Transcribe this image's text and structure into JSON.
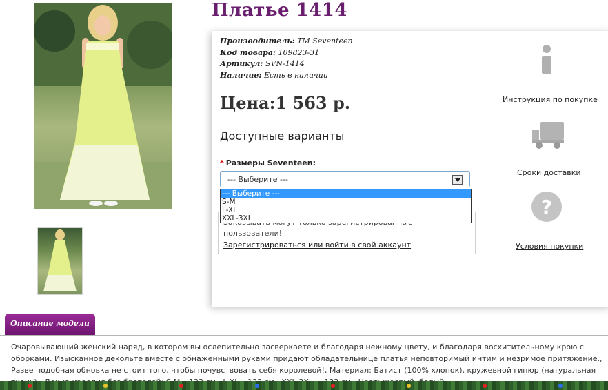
{
  "product": {
    "title": "Платье 1414",
    "meta": [
      {
        "label": "Производитель:",
        "value": "TM Seventeen"
      },
      {
        "label": "Код товара:",
        "value": "109823-31"
      },
      {
        "label": "Артикул:",
        "value": "SVN-1414"
      },
      {
        "label": "Наличие:",
        "value": "Есть в наличии"
      }
    ],
    "price": "Цена:1 563 р."
  },
  "options": {
    "heading": "Доступные варианты",
    "size_label": "Размеры Seventeen:",
    "required_mark": "*",
    "selected": "--- Выберите ---",
    "list": [
      "--- Выберите ---",
      "S-M",
      "L-XL",
      "XXL-3XL"
    ]
  },
  "login_notice": {
    "line1": "Заказывать могут только зарегистрированные",
    "line2": "пользователи!",
    "link": "Зарегистрироваться или войти в свой аккаунт"
  },
  "sidebar": [
    {
      "icon": "info-icon",
      "label": "Инструкция по покупке"
    },
    {
      "icon": "truck-icon",
      "label": "Сроки доставки"
    },
    {
      "icon": "question-icon",
      "label": "Условия покупки"
    }
  ],
  "description": {
    "tab": "Описание модели",
    "text": "Очаровывающий женский наряд, в котором вы ослепительно засверкаете и благодаря нежному цвету, и благодаря восхитительному крою с оборками. Изысканное декольте вместе с обнаженными руками придают обладательнице платья неповторимый интим и незримое притяжение., Разве подобная обновка не стоит того, чтобы почувствовать себя королевой!, Материал: Батист (100% хлопок), кружевной гипюр (натуральная ткань)., Длина изделия без бретелей: S-M= 133 см., L-XL= 133 см., XXL-3XL = 133 см., Цвет: желтый, белый."
  },
  "colors": {
    "title": "#6a1f6e",
    "tab": "#8a2488",
    "dress": "#e4f08c",
    "select_highlight": "#3399ff"
  }
}
